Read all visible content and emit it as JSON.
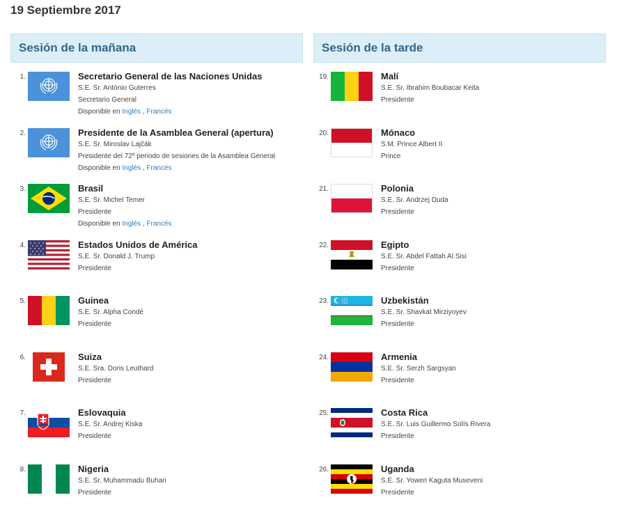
{
  "date": "19 Septiembre 2017",
  "morning": {
    "title": "Sesión de la mañana",
    "entries": [
      {
        "num": "1.",
        "flag": "un-flag-icon",
        "name": "Secretario General de las Naciones Unidas",
        "speaker": "S.E. Sr. António Guterres",
        "role": "Secretario General",
        "available": true
      },
      {
        "num": "2.",
        "flag": "un-flag-icon",
        "name": "Presidente de la Asamblea General (apertura)",
        "speaker": "S.E. Sr. Miroslav Lajčák",
        "role": "Presidente del 72º periodo de sesiones de la Asamblea General",
        "available": true
      },
      {
        "num": "3.",
        "flag": "brazil-flag-icon",
        "name": "Brasil",
        "speaker": "S.E. Sr. Michel Temer",
        "role": "Presidente",
        "available": true
      },
      {
        "num": "4.",
        "flag": "usa-flag-icon",
        "name": "Estados Unidos de América",
        "speaker": "S.E. Sr. Donald J. Trump",
        "role": "Presidente",
        "available": false
      },
      {
        "num": "5.",
        "flag": "guinea-flag-icon",
        "name": "Guinea",
        "speaker": "S.E. Sr. Alpha Condé",
        "role": "Presidente",
        "available": false
      },
      {
        "num": "6.",
        "flag": "switzerland-flag-icon",
        "name": "Suiza",
        "speaker": "S.E. Sra. Doris Leuthard",
        "role": "Presidente",
        "available": false
      },
      {
        "num": "7.",
        "flag": "slovakia-flag-icon",
        "name": "Eslovaquia",
        "speaker": "S.E. Sr. Andrej Kiska",
        "role": "Presidente",
        "available": false
      },
      {
        "num": "8.",
        "flag": "nigeria-flag-icon",
        "name": "Nigeria",
        "speaker": "S.E. Sr. Muhammadu Buhari",
        "role": "Presidente",
        "available": false
      }
    ]
  },
  "afternoon": {
    "title": "Sesión de la tarde",
    "entries": [
      {
        "num": "19.",
        "flag": "mali-flag-icon",
        "name": "Malí",
        "speaker": "S.E. Sr. Ibrahim Boubacar Keita",
        "role": "Presidente",
        "available": false
      },
      {
        "num": "20.",
        "flag": "monaco-flag-icon",
        "name": "Mónaco",
        "speaker": "S.M. Prince Albert II",
        "role": "Prince",
        "available": false
      },
      {
        "num": "21.",
        "flag": "poland-flag-icon",
        "name": "Polonia",
        "speaker": "S.E. Sr. Andrzej Duda",
        "role": "Presidente",
        "available": false
      },
      {
        "num": "22.",
        "flag": "egypt-flag-icon",
        "name": "Egipto",
        "speaker": "S.E. Sr. Abdel Fattah Al Sisi",
        "role": "Presidente",
        "available": false
      },
      {
        "num": "23.",
        "flag": "uzbekistan-flag-icon",
        "name": "Uzbekistán",
        "speaker": "S.E. Sr. Shavkat Mirziyoyev",
        "role": "Presidente",
        "available": false
      },
      {
        "num": "24.",
        "flag": "armenia-flag-icon",
        "name": "Armenia",
        "speaker": "S.E. Sr. Serzh Sargsyan",
        "role": "Presidente",
        "available": false
      },
      {
        "num": "25.",
        "flag": "costa-rica-flag-icon",
        "name": "Costa Rica",
        "speaker": "S.E. Sr. Luis Guillermo Solís Rivera",
        "role": "Presidente",
        "available": false
      },
      {
        "num": "26.",
        "flag": "uganda-flag-icon",
        "name": "Uganda",
        "speaker": "S.E. Sr. Yoweri Kaguta Museveni",
        "role": "Presidente",
        "available": false
      }
    ]
  },
  "availability": {
    "prefix": "Disponible en",
    "lang1": "Inglés",
    "separator": ",",
    "lang2": "Francés"
  }
}
